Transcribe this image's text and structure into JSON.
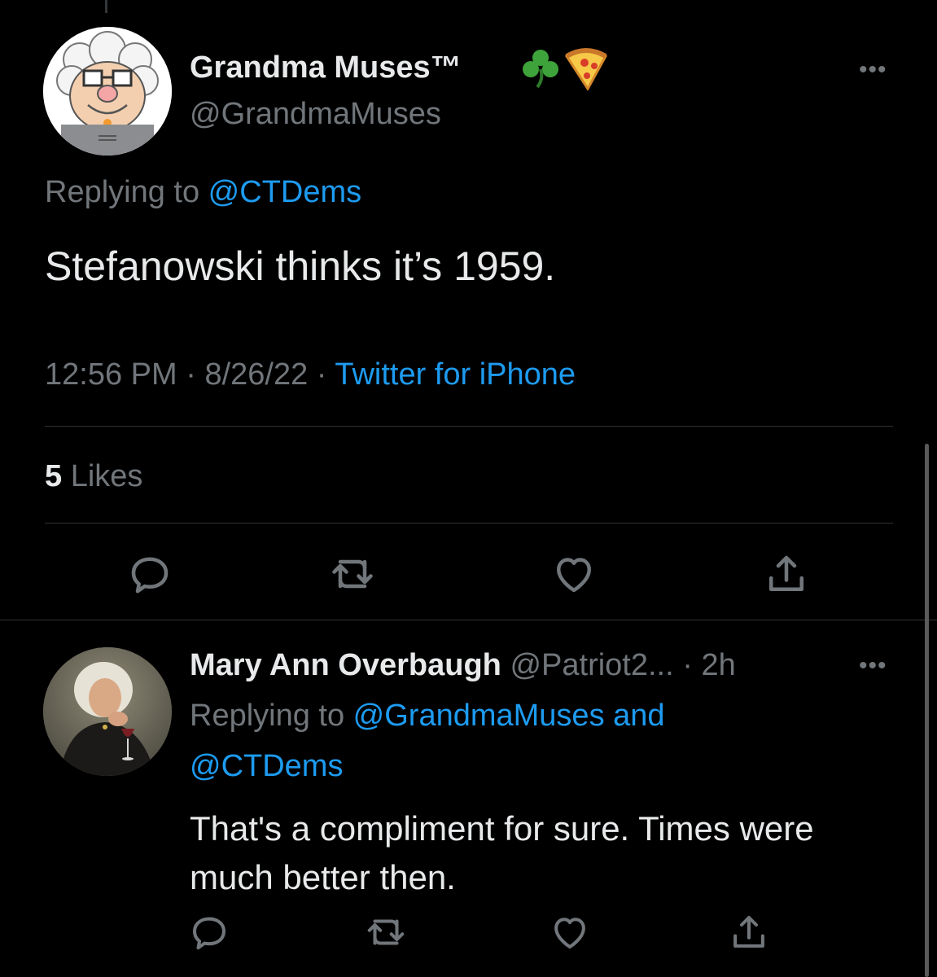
{
  "main_tweet": {
    "display_name": "Grandma Muses™",
    "name_emojis": [
      "shamrock-emoji",
      "pizza-emoji"
    ],
    "handle": "@GrandmaMuses",
    "replying_prefix": "Replying to ",
    "replying_to": "@CTDems",
    "text": "Stefanowski thinks it’s 1959.",
    "time": "12:56 PM",
    "separator": " · ",
    "date": "8/26/22",
    "source": "Twitter for iPhone",
    "likes_count": "5",
    "likes_label": " Likes",
    "more_label": "•••"
  },
  "reply_tweet": {
    "display_name": "Mary Ann Overbaugh",
    "handle": "@Patriot2...",
    "separator": " · ",
    "age": "2h",
    "replying_prefix": "Replying to ",
    "replying_to_line1": "@GrandmaMuses and",
    "replying_to_line2": "@CTDems",
    "text": "That's a compliment for sure.  Times were much better then.",
    "more_label": "•••"
  },
  "action_icons": [
    "reply-icon",
    "retweet-icon",
    "like-icon",
    "share-icon"
  ],
  "colors": {
    "background": "#000000",
    "text_primary": "#e7e9ea",
    "text_secondary": "#71767b",
    "link": "#1d9bf0",
    "divider": "#2f3336"
  }
}
